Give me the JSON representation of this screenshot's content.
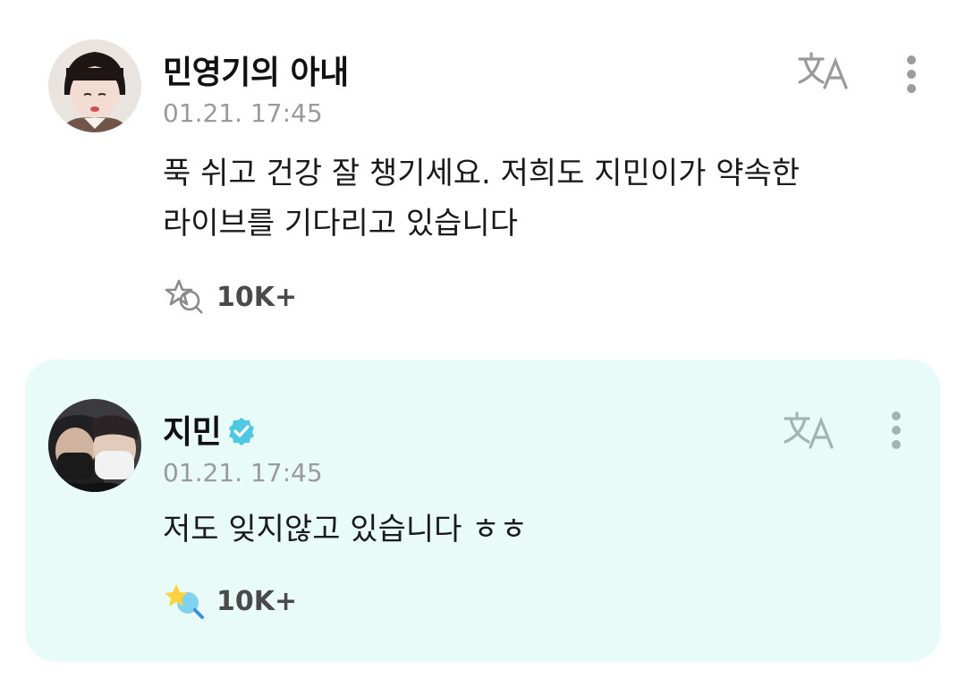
{
  "comment": {
    "author": "민영기의 아내",
    "timestamp": "01.21. 17:45",
    "text_lines": [
      "푹 쉬고 건강 잘 챙기세요. 저희도 지민이가 약속한",
      "라이브를 기다리고 있습니다"
    ],
    "reaction_count": "10K+",
    "translate_icon": "translate-icon",
    "more_icon": "more-vertical-icon"
  },
  "reply": {
    "author": "지민",
    "verified": true,
    "timestamp": "01.21. 17:45",
    "text_lines": [
      "저도 잊지않고 있습니다 ㅎㅎ"
    ],
    "reaction_count": "10K+",
    "background_color": "#e8fbf8",
    "accent_color": "#2ec4c0"
  }
}
